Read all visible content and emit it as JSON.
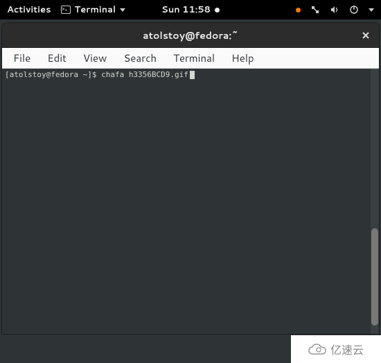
{
  "topbar": {
    "activities_label": "Activities",
    "app_name": "Terminal",
    "clock": "Sun 11:58"
  },
  "window": {
    "title": "atolstoy@fedora:~"
  },
  "menubar": {
    "items": [
      {
        "label": "File"
      },
      {
        "label": "Edit"
      },
      {
        "label": "View"
      },
      {
        "label": "Search"
      },
      {
        "label": "Terminal"
      },
      {
        "label": "Help"
      }
    ]
  },
  "terminal": {
    "prompt": "[atolstoy@fedora ~]$ ",
    "command": "chafa h3356BCD9.gif"
  },
  "watermark": {
    "text": "亿速云"
  }
}
